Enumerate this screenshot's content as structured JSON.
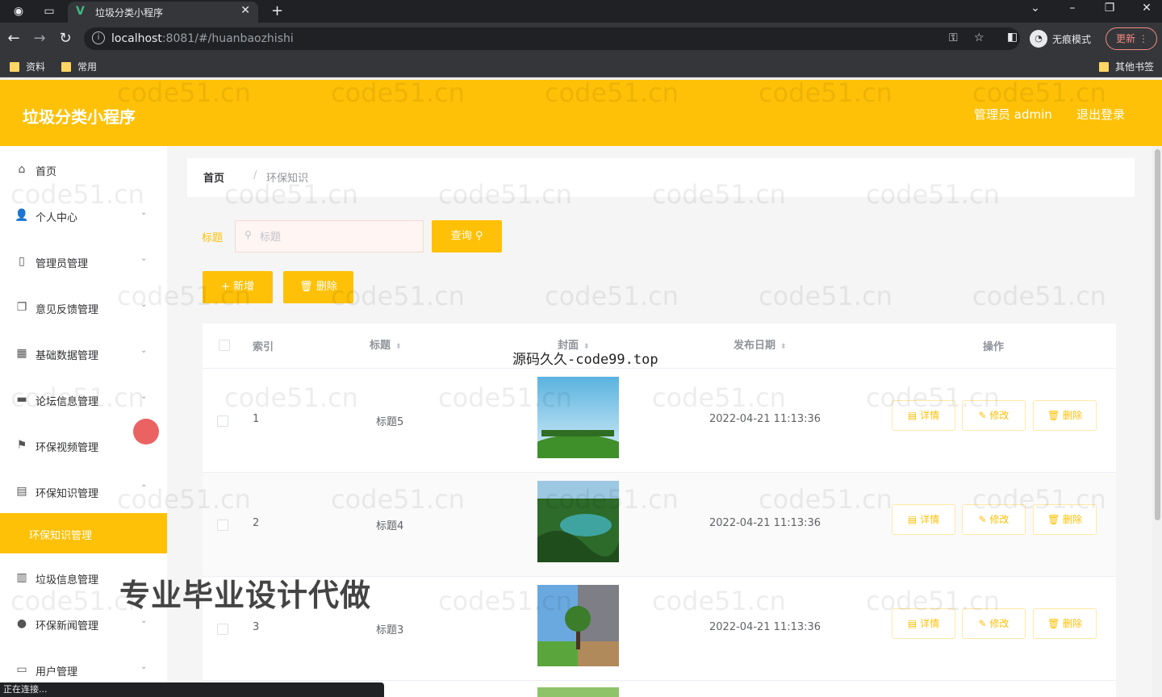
{
  "browser": {
    "tab_title": "垃圾分类小程序",
    "url_host": "localhost",
    "url_rest": ":8081/#/huanbaozhishi",
    "incognito_label": "无痕模式",
    "update_label": "更新",
    "bookmarks": [
      "资料",
      "常用"
    ],
    "other_bookmarks": "其他书签",
    "status_text": "正在连接..."
  },
  "header": {
    "title": "垃圾分类小程序",
    "admin_label": "管理员 admin",
    "logout_label": "退出登录"
  },
  "sidebar": {
    "items": [
      {
        "label": "首页",
        "icon": "home-icon"
      },
      {
        "label": "个人中心",
        "icon": "user-icon"
      },
      {
        "label": "管理员管理",
        "icon": "phone-icon"
      },
      {
        "label": "意见反馈管理",
        "icon": "copy-icon"
      },
      {
        "label": "基础数据管理",
        "icon": "grid-icon"
      },
      {
        "label": "论坛信息管理",
        "icon": "monitor-icon"
      },
      {
        "label": "环保视频管理",
        "icon": "flag-icon"
      },
      {
        "label": "环保知识管理",
        "icon": "document-icon"
      },
      {
        "label": "垃圾信息管理",
        "icon": "bar-chart-icon"
      },
      {
        "label": "环保新闻管理",
        "icon": "location-icon"
      },
      {
        "label": "用户管理",
        "icon": "message-icon"
      }
    ],
    "active_sub": "环保知识管理"
  },
  "breadcrumb": {
    "home": "首页",
    "separator": "/",
    "current": "环保知识"
  },
  "search": {
    "label": "标题",
    "placeholder": "标题",
    "query_button": "查询"
  },
  "actions": {
    "add_button": "+ 新增",
    "delete_button": "删除"
  },
  "table": {
    "headers": {
      "index": "索引",
      "title": "标题",
      "cover": "封面",
      "date": "发布日期",
      "ops": "操作"
    },
    "rows": [
      {
        "index": "1",
        "title": "标题5",
        "date": "2022-04-21 11:13:36"
      },
      {
        "index": "2",
        "title": "标题4",
        "date": "2022-04-21 11:13:36"
      },
      {
        "index": "3",
        "title": "标题3",
        "date": "2022-04-21 11:13:36"
      }
    ],
    "op_labels": {
      "detail": "详情",
      "edit": "修改",
      "delete": "删除"
    }
  },
  "overlays": {
    "site_text": "源码久久-code99.top",
    "ad_text": "专业毕业设计代做",
    "watermark": "code51.cn"
  },
  "colors": {
    "accent": "#ffc107",
    "header_text": "#ffffff"
  }
}
